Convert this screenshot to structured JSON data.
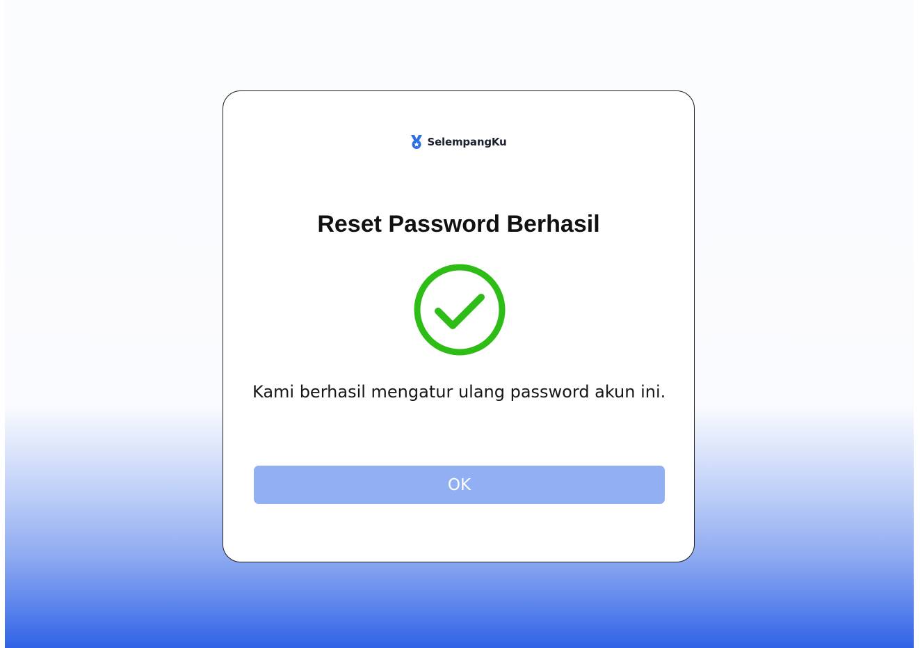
{
  "brand": {
    "name": "SelempangKu",
    "icon": "medal-ribbon-icon",
    "icon_color": "#2f6fe4"
  },
  "dialog": {
    "title": "Reset Password Berhasil",
    "status_icon": "check-circle-icon",
    "status_color": "#2ebd16",
    "message": "Kami berhasil mengatur ulang password akun ini.",
    "ok_label": "OK",
    "ok_button_color": "#91aff2"
  },
  "background": {
    "top_color": "#fbfcfe",
    "bottom_color": "#2f62e6"
  }
}
